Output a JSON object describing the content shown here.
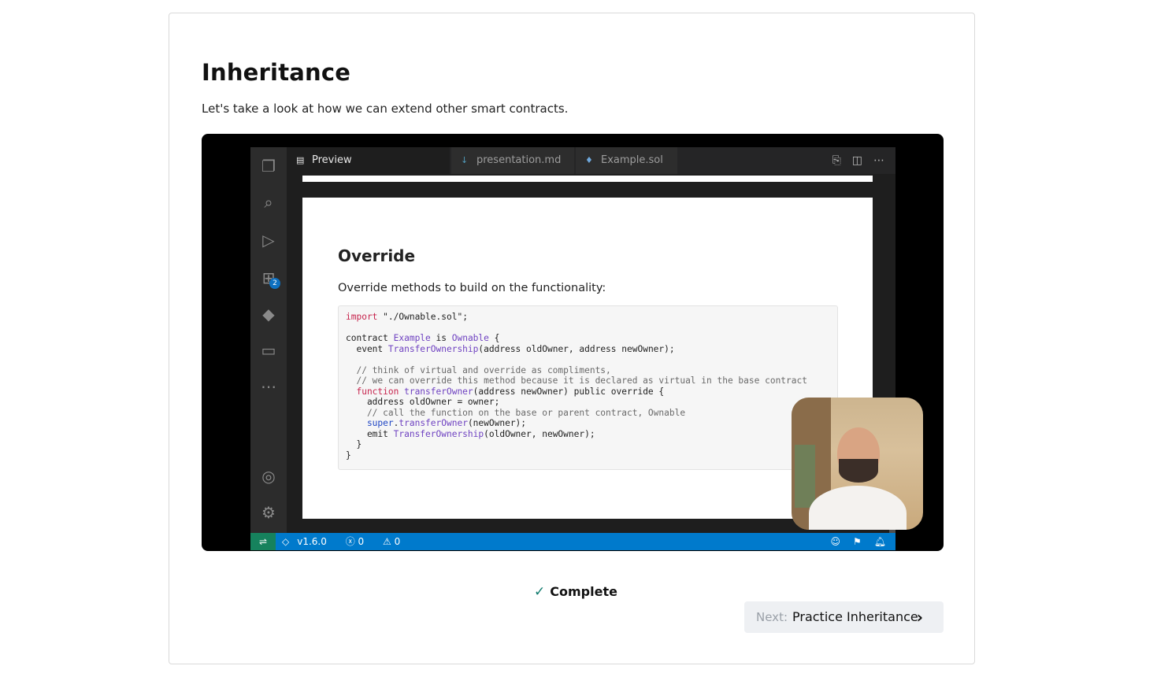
{
  "lesson": {
    "title": "Inheritance",
    "description": "Let's take a look at how we can extend other smart contracts."
  },
  "video": {
    "vscode": {
      "tabs": [
        {
          "label": "Preview presentation.md",
          "icon": "preview-icon",
          "active": true,
          "close": "✕"
        },
        {
          "label": "presentation.md",
          "icon": "markdown-icon",
          "active": false
        },
        {
          "label": "Example.sol",
          "icon": "solidity-icon",
          "active": false
        }
      ],
      "activity_icons": [
        "files-icon",
        "search-icon",
        "run-debug-icon",
        "extensions-icon",
        "terraform-icon",
        "window-icon",
        "more-icon",
        "account-icon",
        "settings-icon"
      ],
      "extensions_badge": "2",
      "status": {
        "version": "v1.6.0",
        "errors": "0",
        "warnings": "0"
      }
    },
    "slide": {
      "heading": "Override",
      "text": "Override methods to build on the functionality:",
      "code": [
        [
          {
            "t": "import",
            "c": "k"
          },
          {
            "t": " \"./Ownable.sol\";",
            "c": ""
          }
        ],
        [],
        [
          {
            "t": "contract ",
            "c": ""
          },
          {
            "t": "Example",
            "c": "t"
          },
          {
            "t": " is ",
            "c": ""
          },
          {
            "t": "Ownable",
            "c": "t"
          },
          {
            "t": " {",
            "c": ""
          }
        ],
        [
          {
            "t": "  event ",
            "c": ""
          },
          {
            "t": "TransferOwnership",
            "c": "f"
          },
          {
            "t": "(address oldOwner, address newOwner);",
            "c": ""
          }
        ],
        [],
        [
          {
            "t": "  // think of virtual and override as compliments,",
            "c": "c"
          }
        ],
        [
          {
            "t": "  // we can override this method because it is declared as virtual in the base contract",
            "c": "c"
          }
        ],
        [
          {
            "t": "  function ",
            "c": "k"
          },
          {
            "t": "transferOwner",
            "c": "f"
          },
          {
            "t": "(address newOwner) public override {",
            "c": ""
          }
        ],
        [
          {
            "t": "    address oldOwner = owner;",
            "c": ""
          }
        ],
        [
          {
            "t": "    // call the function on the base or parent contract, Ownable",
            "c": "c"
          }
        ],
        [
          {
            "t": "    super",
            "c": "b"
          },
          {
            "t": ".",
            "c": ""
          },
          {
            "t": "transferOwner",
            "c": "f"
          },
          {
            "t": "(newOwner);",
            "c": ""
          }
        ],
        [
          {
            "t": "    emit ",
            "c": ""
          },
          {
            "t": "TransferOwnership",
            "c": "f"
          },
          {
            "t": "(oldOwner, newOwner);",
            "c": ""
          }
        ],
        [
          {
            "t": "  }",
            "c": ""
          }
        ],
        [
          {
            "t": "}",
            "c": ""
          }
        ]
      ]
    }
  },
  "footer": {
    "complete_label": "Complete",
    "next_prefix": "Next:",
    "next_label": "Practice Inheritance"
  },
  "colors": {
    "accent_check": "#0f7a6d",
    "statusbar": "#007acc",
    "next_button_bg": "#eef0f3"
  }
}
